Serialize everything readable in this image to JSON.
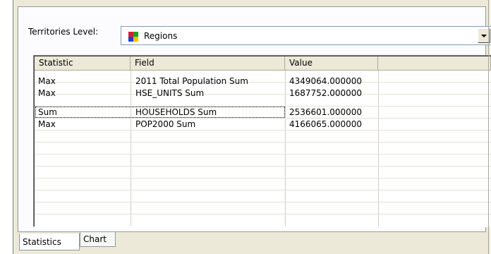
{
  "territories": {
    "label": "Territories Level:",
    "selected": "Regions"
  },
  "table": {
    "columns": [
      "Statistic",
      "Field",
      "Value",
      ""
    ],
    "rows": [
      {
        "statistic": "Max",
        "field": "2011 Total Population Sum",
        "value": "4349064.000000"
      },
      {
        "statistic": "Max",
        "field": "HSE_UNITS Sum",
        "value": "1687752.000000"
      },
      {
        "statistic": "Sum",
        "field": "HOUSEHOLDS Sum",
        "value": "2536601.000000"
      },
      {
        "statistic": "Max",
        "field": "POP2000 Sum",
        "value": "4166065.000000"
      }
    ]
  },
  "tabs": [
    {
      "label": "Statistics",
      "active": true
    },
    {
      "label": "Chart",
      "active": false
    }
  ],
  "icons": {
    "combo_arrow": "chevron-down-icon",
    "region_layer": "layer-icon"
  },
  "colors": {
    "dialog_bg": "#ece9d8",
    "border": "#919b9c",
    "icon": [
      "#e02020",
      "#20a020",
      "#2040d0",
      "#f0c000"
    ]
  }
}
